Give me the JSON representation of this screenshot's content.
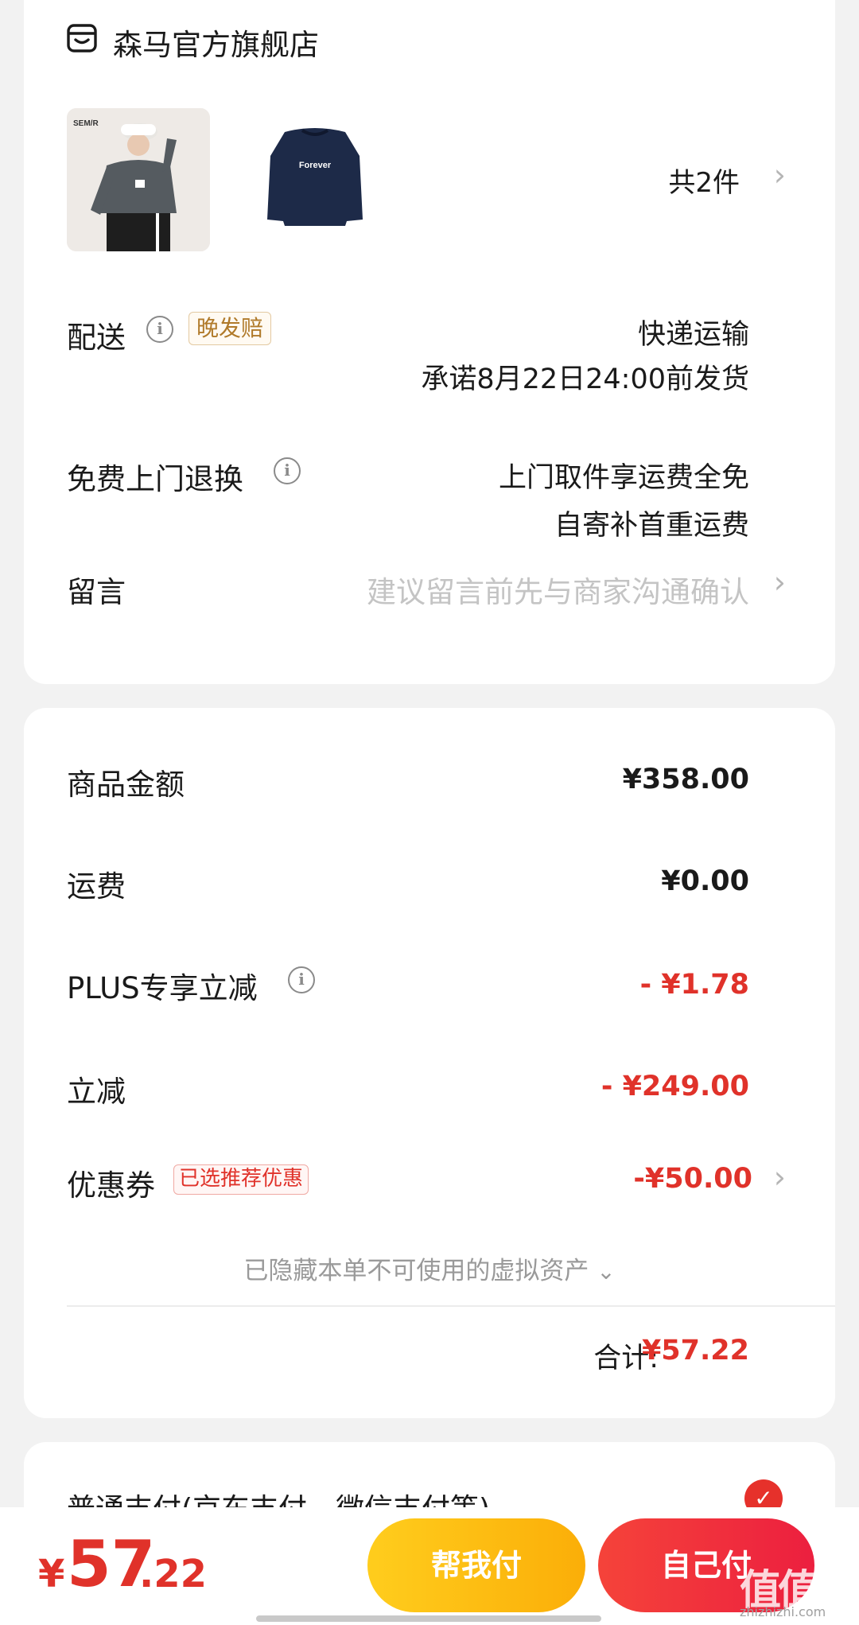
{
  "store": {
    "name": "森马官方旗舰店",
    "icon": "store-icon"
  },
  "products": {
    "thumb1_brand": "SEM/R",
    "thumb2_print": "Forever",
    "count_label": "共2件"
  },
  "delivery": {
    "label": "配送",
    "badge": "晚发赔",
    "method": "快递运输",
    "promise": "承诺8月22日24:00前发货"
  },
  "returns": {
    "label": "免费上门退换",
    "line1": "上门取件享运费全免",
    "line2": "自寄补首重运费"
  },
  "message": {
    "label": "留言",
    "placeholder": "建议留言前先与商家沟通确认"
  },
  "summary": {
    "goods_label": "商品金额",
    "goods_value": "¥358.00",
    "shipping_label": "运费",
    "shipping_value": "¥0.00",
    "plus_label": "PLUS专享立减",
    "plus_value": "- ¥1.78",
    "discount_label": "立减",
    "discount_value": "- ¥249.00",
    "coupon_label": "优惠券",
    "coupon_badge": "已选推荐优惠",
    "coupon_value": "-¥50.00",
    "hidden_assets": "已隐藏本单不可使用的虚拟资产",
    "total_label": "合计:",
    "total_value": "¥57.22"
  },
  "payment": {
    "normal_label": "普通支付(京东支付、微信支付等)"
  },
  "bottom": {
    "yen": "¥",
    "price_int": "57",
    "price_dec": ".22",
    "help_pay": "帮我付",
    "self_pay": "自己付"
  },
  "watermark": {
    "main": "值值值",
    "sub": "zhizhizhi.com"
  },
  "colors": {
    "accent_red": "#e0322a",
    "help_yellow": "#fbb80e",
    "gold_badge": "#b07a2a"
  }
}
